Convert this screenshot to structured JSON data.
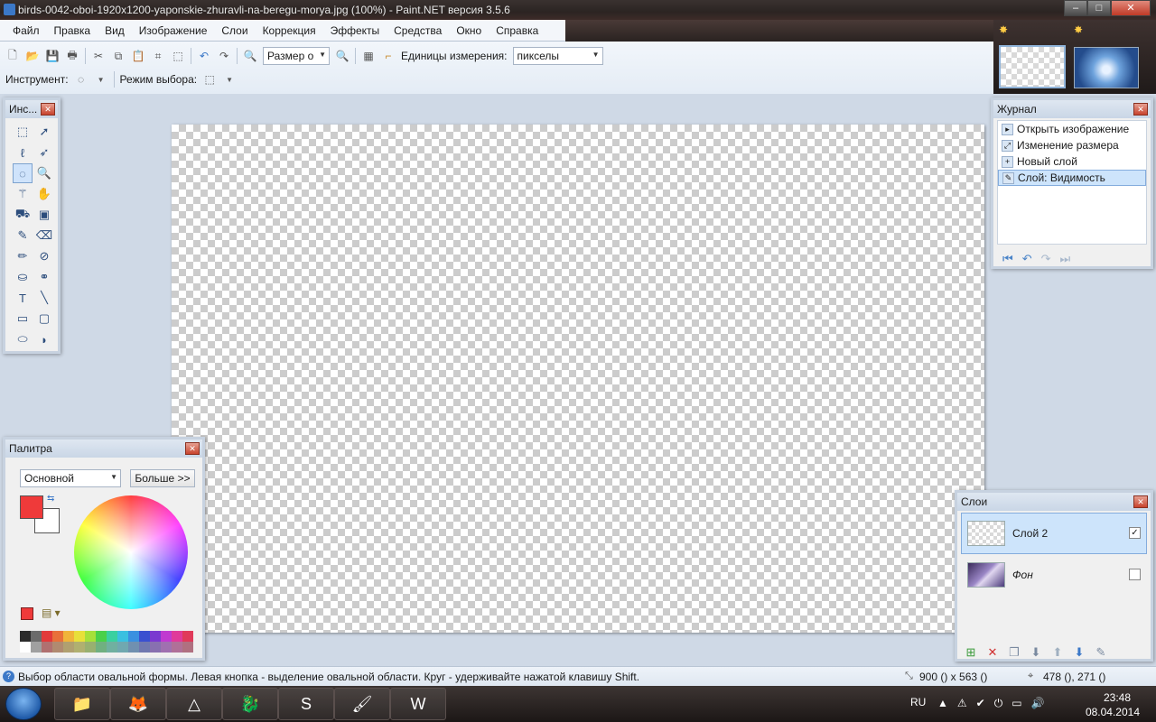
{
  "window": {
    "title": "birds-0042-oboi-1920x1200-yaponskie-zhuravli-na-beregu-morya.jpg (100%) - Paint.NET версия 3.5.6"
  },
  "menu": [
    "Файл",
    "Правка",
    "Вид",
    "Изображение",
    "Слои",
    "Коррекция",
    "Эффекты",
    "Средства",
    "Окно",
    "Справка"
  ],
  "toolbar": {
    "zoom_combo": "Размер о",
    "units_label": "Единицы измерения:",
    "units_value": "пикселы",
    "tool_label": "Инструмент:",
    "selection_mode_label": "Режим выбора:"
  },
  "tools_panel": {
    "title": "Инс..."
  },
  "history_panel": {
    "title": "Журнал",
    "items": [
      "Открыть изображение",
      "Изменение размера",
      "Новый слой",
      "Слой: Видимость"
    ],
    "selected_index": 3
  },
  "palette_panel": {
    "title": "Палитра",
    "palette_select": "Основной",
    "more_button": "Больше >>",
    "primary_color": "#ef3a3a",
    "secondary_color": "#ffffff",
    "swatches_top": [
      "#2b2b2b",
      "#6b6b6b",
      "#e23a3a",
      "#e8703a",
      "#f0b43a",
      "#e8e03a",
      "#a6e03a",
      "#4ad04a",
      "#3ad0a0",
      "#3ac0e0",
      "#3a90e0",
      "#3a50d0",
      "#7a3ad0",
      "#c03ad0",
      "#e03a9a",
      "#e03a5a"
    ],
    "swatches_bottom": [
      "#ffffff",
      "#a0a0a0",
      "#b07070",
      "#b08a70",
      "#b0a070",
      "#b0b070",
      "#98b070",
      "#70b080",
      "#70b0a0",
      "#70a8b0",
      "#7090b0",
      "#7078b0",
      "#8870b0",
      "#a070b0",
      "#b07098",
      "#b07080"
    ]
  },
  "layers_panel": {
    "title": "Слои",
    "layers": [
      {
        "name": "Слой 2",
        "visible": true,
        "selected": true
      },
      {
        "name": "Фон",
        "visible": false,
        "selected": false
      }
    ]
  },
  "status": {
    "hint": "Выбор области овальной формы. Левая кнопка - выделение овальной области. Круг - удерживайте нажатой клавишу Shift.",
    "size": "900 () x 563 ()",
    "position": "478 (), 271 ()"
  },
  "taskbar": {
    "lang": "RU",
    "time": "23:48",
    "date": "08.04.2014"
  }
}
